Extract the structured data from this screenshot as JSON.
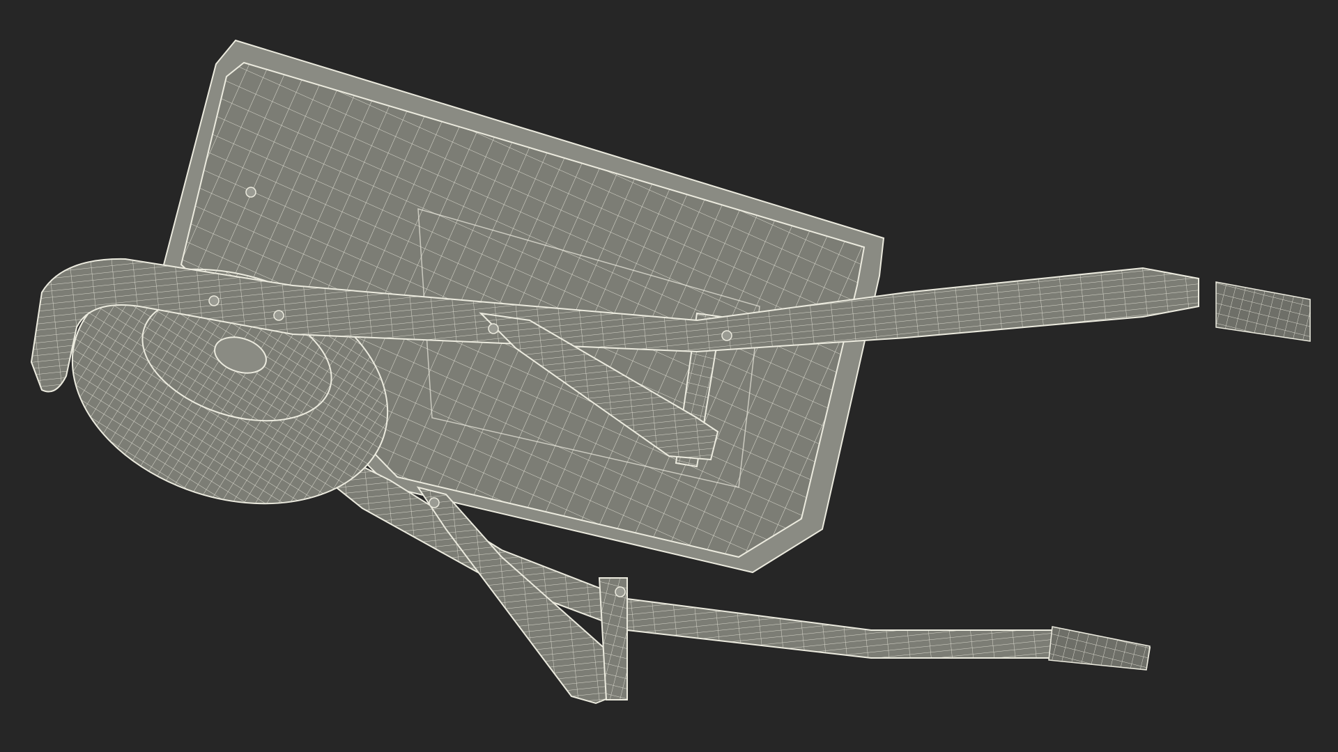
{
  "viewport": {
    "background": "#262626",
    "surface_color": "#7c7d75",
    "surface_dark": "#6a6b63",
    "wire_color": "#ecebdf",
    "rim_color": "#8a8b83"
  },
  "model": {
    "parts": [
      "tray",
      "left-handle",
      "right-handle",
      "wheel",
      "leg-frame",
      "grips",
      "bolts"
    ]
  }
}
